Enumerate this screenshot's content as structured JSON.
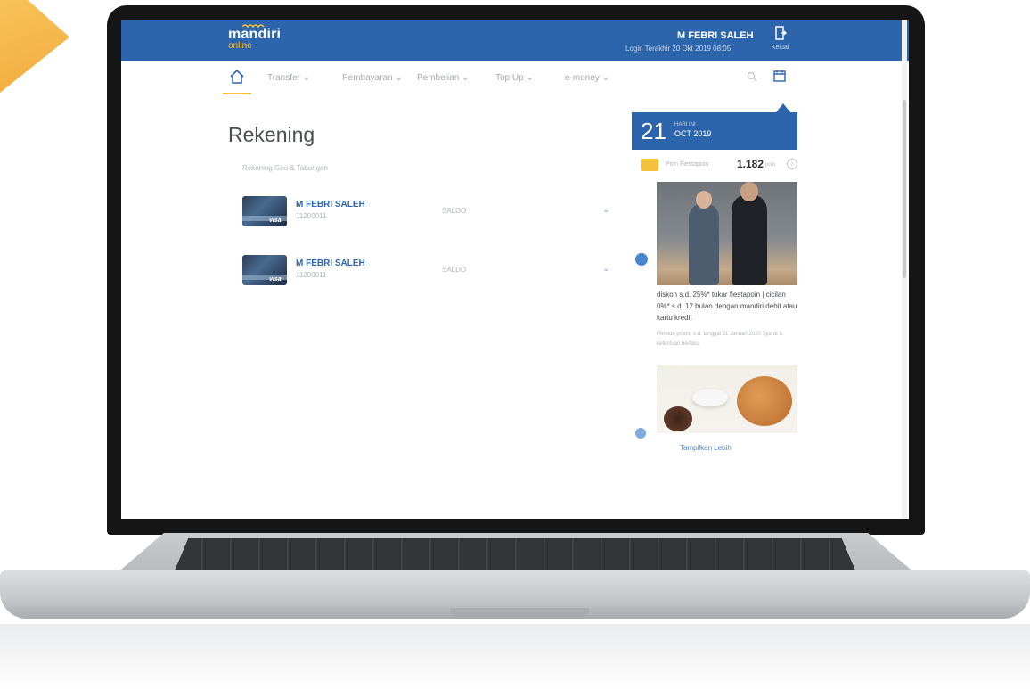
{
  "header": {
    "logo_main": "mandiri",
    "logo_sub": "online",
    "user_name": "M FEBRI SALEH",
    "user_sub": "Login Terakhir 20 Okt 2019 08:05",
    "exit_label": "Keluar",
    "exit_icon": "logout-icon"
  },
  "nav": {
    "home_icon": "home-icon",
    "items": [
      {
        "label": "Transfer ⌄"
      },
      {
        "label": "Pembayaran ⌄"
      },
      {
        "label": "Pembelian ⌄"
      },
      {
        "label": "Top Up ⌄"
      },
      {
        "label": "e-money ⌄"
      }
    ],
    "right_icons": [
      "search-icon",
      "calendar-icon"
    ]
  },
  "main": {
    "title": "Rekening",
    "subtitle": "Rekening Giro & Tabungan",
    "accounts": [
      {
        "name": "M FEBRI SALEH",
        "number": "11200011",
        "balance": "SALDO",
        "card": "visa"
      },
      {
        "name": "M FEBRI SALEH",
        "number": "11200011",
        "balance": "SALDO",
        "card": "visa"
      }
    ]
  },
  "sidebar": {
    "date_day": "21",
    "date_label": "HARI INI",
    "date_month": "OCT 2019",
    "points_label": "Poin Fiestapoin",
    "points_value": "1.182",
    "points_unit": "poin",
    "promo_text": "diskon s.d. 25%* tukar fiestapoin | cicilan 0%* s.d. 12 bulan dengan mandiri debit atau kartu kredit",
    "promo_meta": "Periode promo s.d. tanggal 31 Januari 2020 Syarat & ketentuan berlaku",
    "more_link": "Tampilkan Lebih"
  },
  "colors": {
    "brand_blue": "#2d65ad",
    "accent_yellow": "#f3c13a"
  }
}
